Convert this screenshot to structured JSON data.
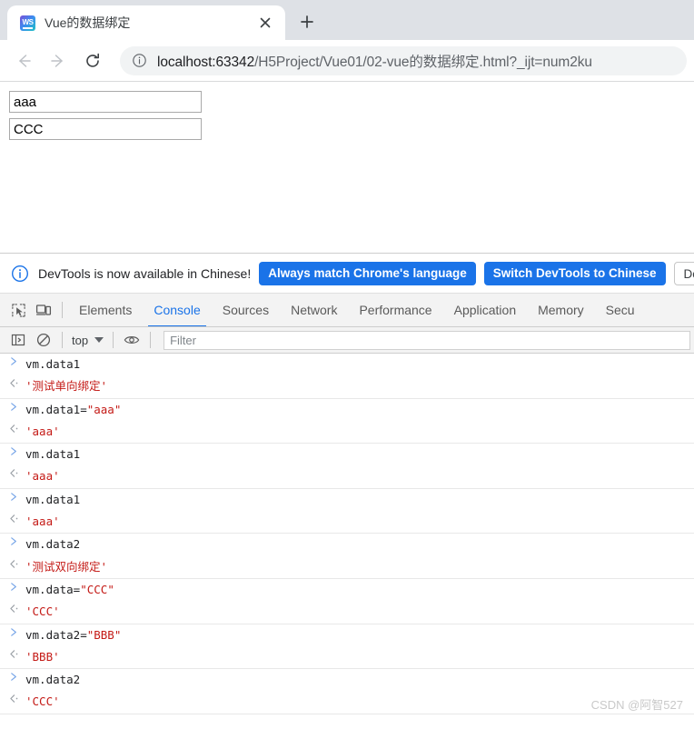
{
  "browser": {
    "tab": {
      "title": "Vue的数据绑定",
      "favicon_name": "webstorm-icon",
      "favicon_text": "WS",
      "close_label": "×"
    },
    "newtab_label": "+",
    "nav": {
      "back_label": "←",
      "forward_label": "→",
      "reload_label": "⟳"
    },
    "omnibox": {
      "security_icon": "info-circle-icon",
      "url_host": "localhost:63342",
      "url_path": "/H5Project/Vue01/02-vue的数据绑定.html?_ijt=num2ku",
      "url_full": "localhost:63342/H5Project/Vue01/02-vue的数据绑定.html?_ijt=num2ku"
    }
  },
  "page": {
    "inputs": [
      {
        "name": "data1-input",
        "value": "aaa",
        "placeholder": ""
      },
      {
        "name": "data2-input",
        "value": "CCC",
        "placeholder": ""
      }
    ]
  },
  "devtools": {
    "notice": {
      "icon": "info-circle-icon",
      "message": "DevTools is now available in Chinese!",
      "buttons": [
        {
          "label": "Always match Chrome's language",
          "style": "primary"
        },
        {
          "label": "Switch DevTools to Chinese",
          "style": "primary"
        },
        {
          "label": "Don't",
          "style": "secondary"
        }
      ]
    },
    "toolbar_icons": [
      {
        "name": "inspect-element-icon"
      },
      {
        "name": "device-toolbar-icon"
      }
    ],
    "tabs": [
      {
        "label": "Elements",
        "active": false
      },
      {
        "label": "Console",
        "active": true
      },
      {
        "label": "Sources",
        "active": false
      },
      {
        "label": "Network",
        "active": false
      },
      {
        "label": "Performance",
        "active": false
      },
      {
        "label": "Application",
        "active": false
      },
      {
        "label": "Memory",
        "active": false
      },
      {
        "label": "Secu",
        "active": false
      }
    ],
    "console_toolbar": {
      "sidebar_icon": "console-sidebar-icon",
      "clear_icon": "clear-console-icon",
      "context": "top",
      "eye_icon": "live-expression-eye-icon",
      "filter_placeholder": "Filter",
      "filter_value": ""
    },
    "console_groups": [
      {
        "input": "vm.data1",
        "output": "'测试单向绑定'"
      },
      {
        "input_parts": [
          {
            "text": "vm.data1=",
            "type": "plain"
          },
          {
            "text": "\"aaa\"",
            "type": "string"
          }
        ],
        "input": "vm.data1=\"aaa\"",
        "output": "'aaa'"
      },
      {
        "input": "vm.data1",
        "output": "'aaa'"
      },
      {
        "input": "vm.data1",
        "output": "'aaa'"
      },
      {
        "input": "vm.data2",
        "output": "'测试双向绑定'"
      },
      {
        "input_parts": [
          {
            "text": "vm.data=",
            "type": "plain"
          },
          {
            "text": "\"CCC\"",
            "type": "string"
          }
        ],
        "input": "vm.data=\"CCC\"",
        "output": "'CCC'"
      },
      {
        "input_parts": [
          {
            "text": "vm.data2=",
            "type": "plain"
          },
          {
            "text": "\"BBB\"",
            "type": "string"
          }
        ],
        "input": "vm.data2=\"BBB\"",
        "output": "'BBB'"
      },
      {
        "input": "vm.data2",
        "output": "'CCC'"
      }
    ],
    "prompt_marker": ">"
  },
  "watermark": "CSDN @阿智527",
  "colors": {
    "accent_blue": "#1a73e8",
    "chrome_bg": "#dee1e6",
    "console_string_red": "#c41a16",
    "devtools_bg": "#f3f3f3"
  }
}
